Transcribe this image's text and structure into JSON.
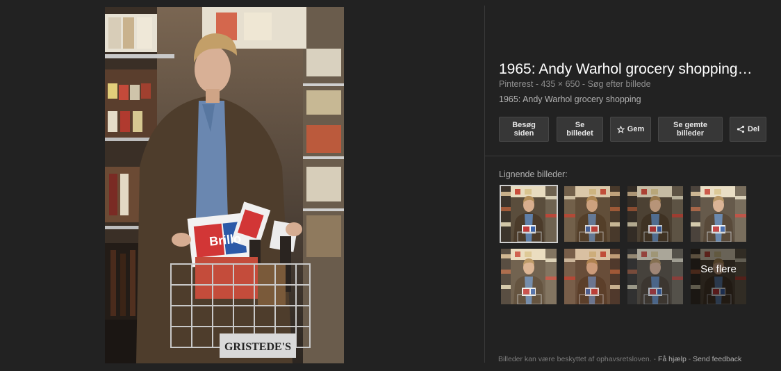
{
  "result": {
    "title": "1965: Andy Warhol grocery shopping…",
    "meta": {
      "source": "Pinterest",
      "dimensions": "435 × 650",
      "search_link": "Søg efter billede"
    },
    "description": "1965: Andy Warhol grocery shopping"
  },
  "actions": {
    "visit_line1": "Besøg",
    "visit_line2": "siden",
    "view_line1": "Se",
    "view_line2": "billedet",
    "save": "Gem",
    "saved_line1": "Se gemte",
    "saved_line2": "billeder",
    "share": "Del"
  },
  "related": {
    "label": "Lignende billeder:",
    "more_label": "Se flere"
  },
  "footer": {
    "notice": "Billeder kan være beskyttet af ophavsretsloven.",
    "help": "Få hjælp",
    "feedback": "Send feedback"
  },
  "icons": {
    "save": "star-icon",
    "share": "share-icon"
  },
  "photo_text": {
    "cart_sign": "GRISTEDE'S",
    "brand": "Brillo"
  },
  "colors": {
    "background": "#222222",
    "button": "#373737",
    "title": "#ffffff"
  }
}
